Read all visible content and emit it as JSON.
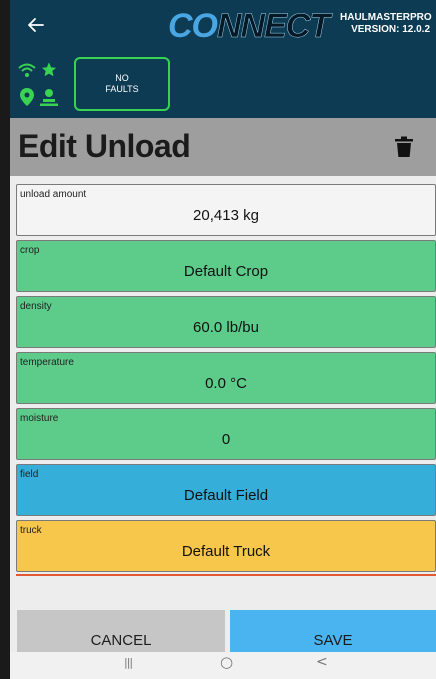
{
  "topbar": {
    "back_icon": "arrow-left-icon",
    "logo_co": "CO",
    "logo_nnect": "NNECT",
    "product": "HAULMASTERPRO",
    "version": "VERSION: 12.0.2"
  },
  "status": {
    "icons": [
      "wifi-icon",
      "star-icon",
      "location-pin-icon",
      "person-icon"
    ],
    "fault_line1": "NO",
    "fault_line2": "FAULTS",
    "fault_color": "#39d353"
  },
  "page": {
    "title": "Edit Unload",
    "delete_icon": "trash-icon"
  },
  "fields": [
    {
      "label": "unload amount",
      "value": "20,413 kg",
      "color": "#f4f4f4"
    },
    {
      "label": "crop",
      "value": "Default Crop",
      "color": "#5dcb8a"
    },
    {
      "label": "density",
      "value": "60.0 lb/bu",
      "color": "#5dcb8a"
    },
    {
      "label": "temperature",
      "value": "0.0 °C",
      "color": "#5dcb8a"
    },
    {
      "label": "moisture",
      "value": "0",
      "color": "#5dcb8a"
    },
    {
      "label": "field",
      "value": "Default Field",
      "color": "#35afd9"
    },
    {
      "label": "truck",
      "value": "Default Truck",
      "color": "#f7c74b"
    }
  ],
  "actions": {
    "cancel": "CANCEL",
    "save": "SAVE"
  },
  "nav": {
    "recents": "|||",
    "home": "○",
    "back": "<"
  }
}
